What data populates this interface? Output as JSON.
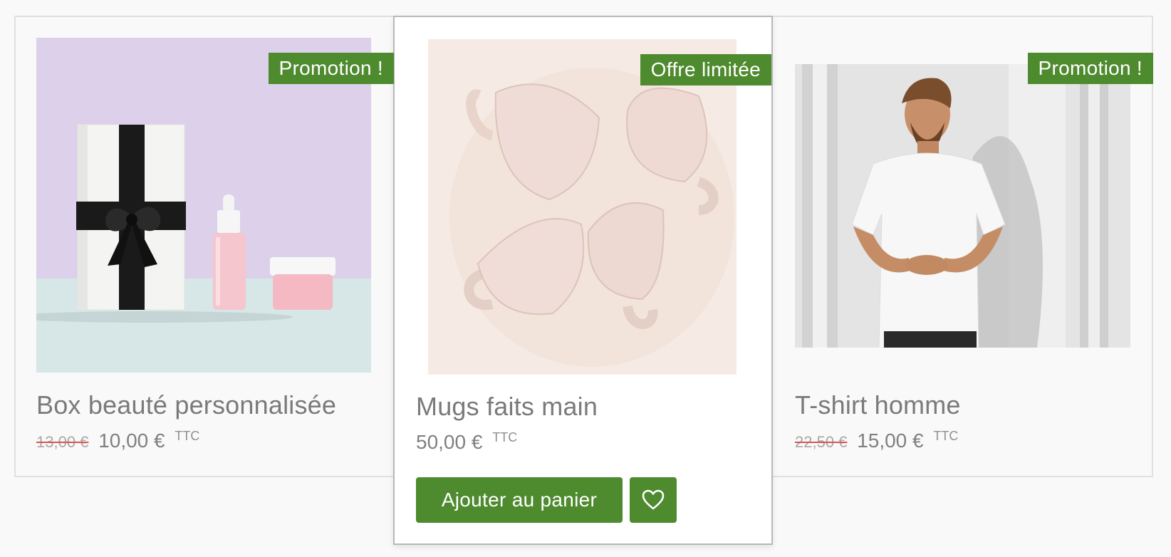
{
  "products": [
    {
      "badge": "Promotion !",
      "title": "Box beauté personnalisée",
      "old_price": "13,00 €",
      "price": "10,00 €",
      "tax_label": "TTC",
      "image_subject": "gift box with ribbon, dropper bottle and pink jar"
    },
    {
      "badge": "Offre limitée",
      "title": "Mugs faits main",
      "price": "50,00 €",
      "tax_label": "TTC",
      "add_to_cart_label": "Ajouter au panier",
      "wishlist_icon": "heart-icon",
      "image_subject": "four handmade ceramic cups"
    },
    {
      "badge": "Promotion !",
      "title": "T-shirt homme",
      "old_price": "22,50 €",
      "price": "15,00 €",
      "tax_label": "TTC",
      "image_subject": "man in white t-shirt against white wall"
    }
  ],
  "colors": {
    "accent_green": "#4e8a2e",
    "strike_red": "#d9534f",
    "text_gray": "#7a7a7a"
  }
}
